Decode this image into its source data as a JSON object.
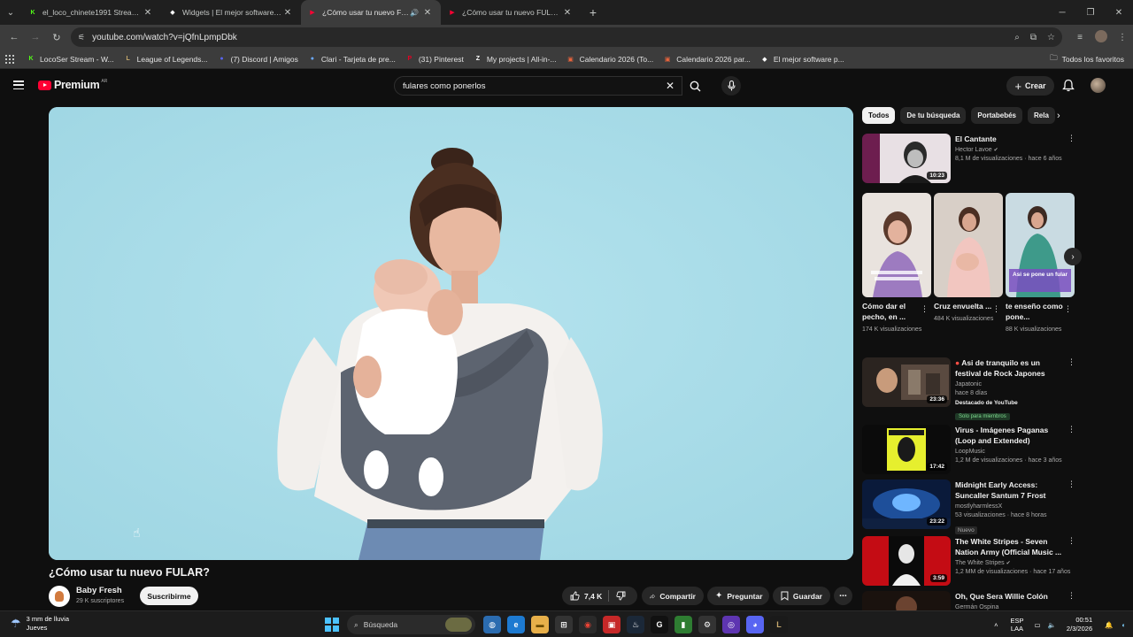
{
  "browser": {
    "tabs": [
      {
        "title": "el_loco_chinete1991 Stream - W",
        "fav_color": "#53fc18",
        "fav_glyph": "K"
      },
      {
        "title": "Widgets | El mejor software pa",
        "fav_color": "#ffffff",
        "fav_glyph": "◆"
      },
      {
        "title": "¿Cómo usar tu nuevo FULAR",
        "fav_color": "#ff0033",
        "fav_glyph": "▶",
        "active": true,
        "audio": true
      },
      {
        "title": "¿Cómo usar tu nuevo FULAR? -",
        "fav_color": "#ff0033",
        "fav_glyph": "▶"
      }
    ],
    "url": "youtube.com/watch?v=jQfnLpmpDbk",
    "bookmarks": [
      {
        "label": "LocoSer Stream - W...",
        "color": "#53fc18",
        "glyph": "K"
      },
      {
        "label": "League of Legends...",
        "color": "#c8aa6e",
        "glyph": "L"
      },
      {
        "label": "(7) Discord | Amigos",
        "color": "#5865f2",
        "glyph": "●"
      },
      {
        "label": "Clari - Tarjeta de pre...",
        "color": "#6aa9ff",
        "glyph": "●"
      },
      {
        "label": "(31) Pinterest",
        "color": "#e60023",
        "glyph": "P"
      },
      {
        "label": "My projects | All-in-...",
        "color": "#ffffff",
        "glyph": "Z"
      },
      {
        "label": "Calendario 2026 (To...",
        "color": "#e8643c",
        "glyph": "▣"
      },
      {
        "label": "Calendario 2026 par...",
        "color": "#e8643c",
        "glyph": "▣"
      },
      {
        "label": "El mejor software p...",
        "color": "#ffffff",
        "glyph": "◆"
      }
    ],
    "all_bookmarks": "Todos los favoritos"
  },
  "youtube": {
    "logo_text": "Premium",
    "region": "AR",
    "search_query": "fulares como ponerlos",
    "create_label": "Crear",
    "video": {
      "title": "¿Cómo usar tu nuevo FULAR?",
      "channel": "Baby Fresh",
      "subscribers": "29 K suscriptores",
      "subscribe_label": "Suscribirme",
      "likes": "7,4 K",
      "share_label": "Compartir",
      "ask_label": "Preguntar",
      "save_label": "Guardar"
    },
    "chips": [
      "Todos",
      "De tu búsqueda",
      "Portabebés",
      "Rela"
    ],
    "recommendations": [
      {
        "title": "El Cantante",
        "channel": "Hector Lavoe",
        "stats": "8,1 M de visualizaciones · hace 6 años",
        "duration": "10:23",
        "verified": true
      },
      {
        "title": "Asi de tranquilo es un festival de Rock Japones",
        "channel": "Japatonic",
        "stats": "hace 8 días",
        "duration": "23:36",
        "badge1": "Destacado de YouTube",
        "badge2": "Solo para miembros"
      },
      {
        "title": "Virus - Imágenes Paganas (Loop and Extended)",
        "channel": "LoopMusic",
        "stats": "1,2 M de visualizaciones · hace 3 años",
        "duration": "17:42"
      },
      {
        "title": "Midnight Early Access: Suncaller Santum 7 Frost Mag...",
        "channel": "mostlyharmlessX",
        "stats": "53 visualizaciones · hace 8 horas",
        "duration": "23:22",
        "badge1": "Nuevo"
      },
      {
        "title": "The White Stripes - Seven Nation Army (Official Music ...",
        "channel": "The White Stripes",
        "stats": "1,2 MM de visualizaciones · hace 17 años",
        "duration": "3:59",
        "verified": true
      },
      {
        "title": "Oh, Que Sera    Willie Colón",
        "channel": "Germán Ospina",
        "stats": "",
        "duration": ""
      }
    ],
    "shorts": [
      {
        "title": "Cómo dar el pecho, en ...",
        "views": "174 K visualizaciones",
        "overlay": ""
      },
      {
        "title": "Cruz envuelta ...",
        "views": "484 K visualizaciones",
        "overlay": ""
      },
      {
        "title": "te enseño como pone...",
        "views": "88 K visualizaciones",
        "overlay": "Asi se pone un fular"
      }
    ]
  },
  "taskbar": {
    "weather_line1": "3 mm de lluvia",
    "weather_line2": "Jueves",
    "search_placeholder": "Búsqueda",
    "lang_line1": "ESP",
    "lang_line2": "LAA",
    "time": "00:51",
    "date": "2/3/2026"
  }
}
